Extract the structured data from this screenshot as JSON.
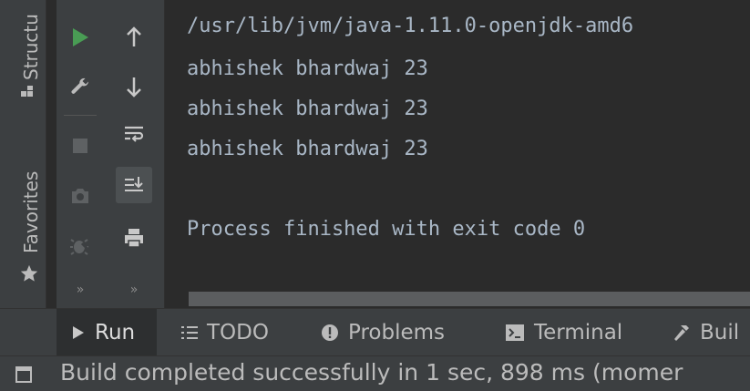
{
  "side_tabs": {
    "structure": "Structu",
    "favorites": "Favorites"
  },
  "console": {
    "lines": [
      "/usr/lib/jvm/java-1.11.0-openjdk-amd6",
      "abhishek bhardwaj 23",
      "abhishek bhardwaj 23",
      "abhishek bhardwaj 23",
      "",
      "Process finished with exit code 0"
    ]
  },
  "tabs": {
    "run": "Run",
    "todo": "TODO",
    "problems": "Problems",
    "terminal": "Terminal",
    "build": "Buil"
  },
  "status": {
    "message": "Build completed successfully in 1 sec, 898 ms (momer"
  },
  "colors": {
    "run_green": "#499c54",
    "text": "#a9b7c6",
    "panel": "#3c3f41",
    "editor": "#2b2b2b"
  }
}
